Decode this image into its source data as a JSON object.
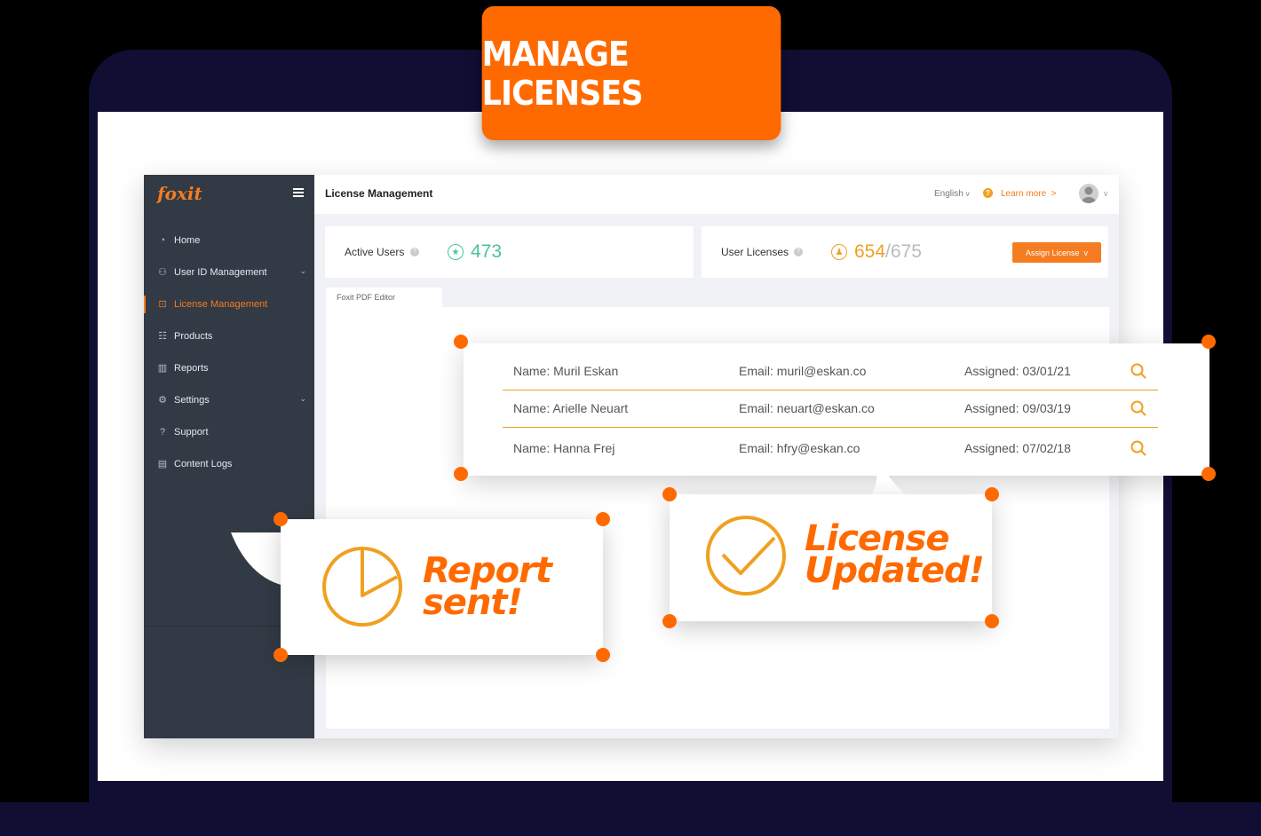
{
  "banner": {
    "title": "MANAGE LICENSES"
  },
  "app": {
    "logo": "foxit",
    "sidebar": {
      "items": [
        {
          "label": "Home",
          "icon": "dashboard-icon",
          "glyph": "◔"
        },
        {
          "label": "User ID Management",
          "icon": "users-icon",
          "glyph": "⚇",
          "chevron": "⌄"
        },
        {
          "label": "License Management",
          "icon": "cast-icon",
          "glyph": "⊡",
          "active": true
        },
        {
          "label": "Products",
          "icon": "list-icon",
          "glyph": "☷"
        },
        {
          "label": "Reports",
          "icon": "chart-icon",
          "glyph": "▥"
        },
        {
          "label": "Settings",
          "icon": "gear-icon",
          "glyph": "⚙",
          "chevron": "⌄"
        },
        {
          "label": "Support",
          "icon": "question-icon",
          "glyph": "?"
        },
        {
          "label": "Content Logs",
          "icon": "clipboard-icon",
          "glyph": "▤"
        }
      ]
    },
    "header": {
      "title": "License Management",
      "language": "English",
      "learn_more": "Learn more",
      "learn_more_arrow": ">",
      "chevron": "v"
    },
    "stats": {
      "active_users_label": "Active Users",
      "active_users_value": "473",
      "user_licenses_label": "User Licenses",
      "licenses_used": "654",
      "licenses_separator": "/",
      "licenses_total": "675",
      "assign_button": "Assign License"
    },
    "tab": {
      "label": "Foxit PDF Editor"
    }
  },
  "users": [
    {
      "name": "Name: Muril Eskan",
      "email": "Email: muril@eskan.co",
      "assigned": "Assigned: 03/01/21"
    },
    {
      "name": "Name: Arielle Neuart",
      "email": "Email: neuart@eskan.co",
      "assigned": "Assigned: 09/03/19"
    },
    {
      "name": "Name: Hanna Frej",
      "email": "Email: hfry@eskan.co",
      "assigned": "Assigned: 07/02/18"
    }
  ],
  "callouts": {
    "report_line1": "Report",
    "report_line2": "sent!",
    "license_line1": "License",
    "license_line2": "Updated!"
  },
  "colors": {
    "accent": "#ff6a00",
    "sidebar": "#323a45",
    "gold": "#f0a020",
    "green": "#47c3a0",
    "frame": "#100e33"
  }
}
